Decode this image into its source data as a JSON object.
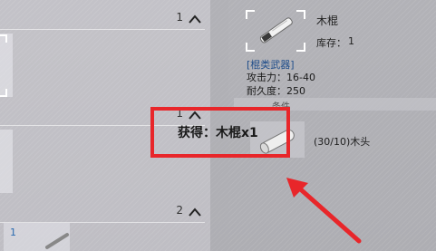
{
  "inventory_list": {
    "groups": [
      {
        "count": "1"
      },
      {
        "count": "1"
      },
      {
        "count": "2"
      }
    ],
    "bottom_slot_count": "1"
  },
  "item_detail": {
    "name": "木棍",
    "stock_label": "库存：",
    "stock_value": "1",
    "category": "[棍类武器]",
    "stats": [
      "攻击力：16-40",
      "耐久度：250"
    ],
    "section_title": "条件",
    "material_label": "(30/10)木头"
  },
  "toast": {
    "text": "获得：木棍x1"
  },
  "colors": {
    "highlight": "#e8262a",
    "category_text": "#1f4d8a"
  }
}
